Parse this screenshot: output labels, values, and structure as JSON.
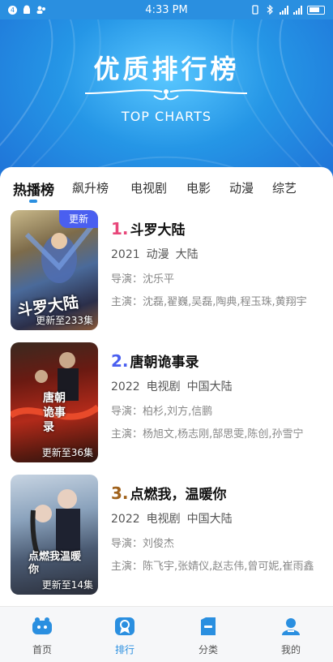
{
  "status_bar": {
    "time": "4:33 PM",
    "notif_badge": "4"
  },
  "banner": {
    "title": "优质排行榜",
    "subtitle": "TOP CHARTS"
  },
  "tabs": [
    {
      "label": "热播榜",
      "active": true
    },
    {
      "label": "飙升榜",
      "active": false
    },
    {
      "label": "电视剧",
      "active": false
    },
    {
      "label": "电影",
      "active": false
    },
    {
      "label": "动漫",
      "active": false
    },
    {
      "label": "综艺",
      "active": false
    }
  ],
  "labels": {
    "director": "导演：",
    "cast": "主演："
  },
  "items": [
    {
      "rank": "1.",
      "rank_color": "#e8477a",
      "title": "斗罗大陆",
      "year": "2021",
      "genre": "动漫",
      "region": "大陆",
      "director": "沈乐平",
      "cast": "沈磊,翟巍,吴磊,陶典,程玉珠,黄翔宇",
      "episodes": "更新至233集",
      "badge": "更新",
      "poster_art": "斗罗大陆"
    },
    {
      "rank": "2.",
      "rank_color": "#4a5ff0",
      "title": "唐朝诡事录",
      "year": "2022",
      "genre": "电视剧",
      "region": "中国大陆",
      "director": "柏杉,刘方,信鹏",
      "cast": "杨旭文,杨志刚,郜思雯,陈创,孙雪宁",
      "episodes": "更新至36集",
      "badge": "",
      "poster_art": "唐朝诡事录"
    },
    {
      "rank": "3.",
      "rank_color": "#a0621c",
      "title": "点燃我，温暖你",
      "year": "2022",
      "genre": "电视剧",
      "region": "中国大陆",
      "director": "刘俊杰",
      "cast": "陈飞宇,张婧仪,赵志伟,曾可妮,崔雨鑫",
      "episodes": "更新至14集",
      "badge": "",
      "poster_art": "点燃我温暖你"
    }
  ],
  "bottom_nav": [
    {
      "label": "首页",
      "icon": "home-icon",
      "active": false
    },
    {
      "label": "排行",
      "icon": "ranking-icon",
      "active": true
    },
    {
      "label": "分类",
      "icon": "category-icon",
      "active": false
    },
    {
      "label": "我的",
      "icon": "profile-icon",
      "active": false
    }
  ],
  "colors": {
    "accent": "#2a8fe0",
    "badge": "#4a5ff0"
  }
}
